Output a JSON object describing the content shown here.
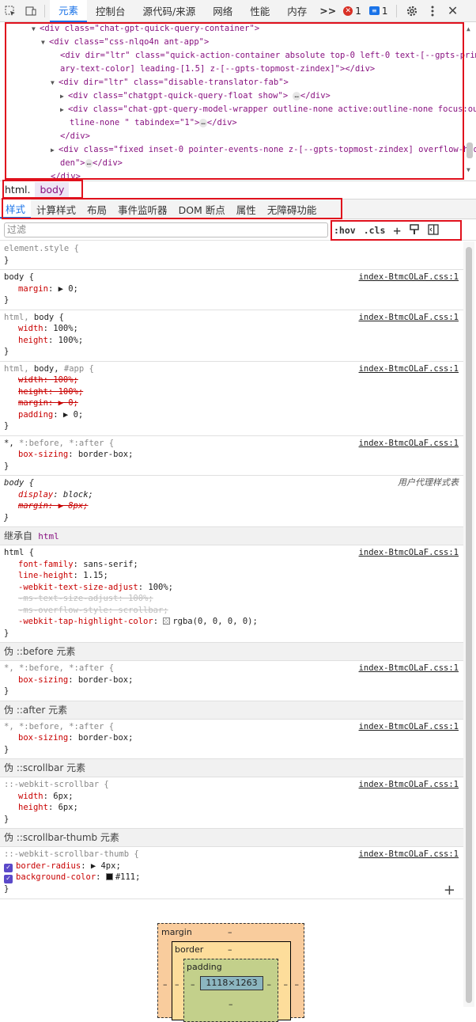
{
  "toolbar": {
    "tabs": [
      "元素",
      "控制台",
      "源代码/来源",
      "网络",
      "性能",
      "内存"
    ],
    "more": ">>",
    "errors": "1",
    "messages": "1",
    "colors": {
      "accent": "#1a73e8",
      "error": "#d93025"
    }
  },
  "dom": {
    "lines": [
      {
        "a": "<div class=\"chat-gpt-quick-query-container\">"
      },
      {
        "a": "<div class=\"css-nlqo4n ant-app\">"
      },
      {
        "a": "<div dir=\"ltr\" class=\"quick-action-container absolute top-0 left-0 text-[--gpts-prim"
      },
      {
        "a": "ary-text-color] leading-[1.5] z-[--gpts-topmost-zindex]\"></div>"
      },
      {
        "a": "<div dir=\"ltr\" class=\"disable-translator-fab\">"
      },
      {
        "a": "<div class=\"chatgpt-quick-query-float show\">",
        "b": "</div>"
      },
      {
        "a": "<div class=\"chat-gpt-query-model-wrapper outline-none active:outline-none focus:ou"
      },
      {
        "a": "tline-none \" tabindex=\"1\">",
        "b": "</div>"
      },
      {
        "a": "</div>"
      },
      {
        "a": "<div class=\"fixed inset-0 pointer-events-none z-[--gpts-topmost-zindex] overflow-hid"
      },
      {
        "a": "den\">",
        "b": "</div>"
      },
      {
        "a": "</div>"
      }
    ],
    "ellipsis": "…"
  },
  "breadcrumb": [
    "html.",
    "body"
  ],
  "subtabs": [
    "样式",
    "计算样式",
    "布局",
    "事件监听器",
    "DOM 断点",
    "属性",
    "无障碍功能"
  ],
  "filter": {
    "placeholder": "过滤",
    "hov": ":hov",
    "cls": ".cls",
    "add": "+"
  },
  "styles": {
    "element_style": "element.style {",
    "close": "}",
    "src": "index-BtmcOLaF.css:1",
    "ua": "用户代理样式表",
    "r1_sel": "body {",
    "r1_p1": "margin",
    "r1_v1": "▶ 0;",
    "r2_sel_a": "html,",
    "r2_sel_b": " body {",
    "r2_p1": "width",
    "r2_v1": "100%;",
    "r2_p2": "height",
    "r2_v2": "100%;",
    "r3_sel_a": "html,",
    "r3_sel_b": " body,",
    "r3_sel_c": " #app {",
    "r3_p1": "width: 100%;",
    "r3_p2": "height: 100%;",
    "r3_p3": "margin: ▶ 0;",
    "r3_p4": "padding",
    "r3_v4": "▶ 0;",
    "r4_sel_a": "*,",
    "r4_sel_b": " *:before, *:after {",
    "r4_p1": "box-sizing",
    "r4_v1": "border-box;",
    "r5_sel": "body {",
    "r5_p1": "display",
    "r5_v1": "block;",
    "r5_p2": "margin: ▶ 8px;",
    "inherit": "继承自",
    "inherit_el": "html",
    "r6_sel": "html {",
    "r6_p1": "font-family",
    "r6_v1": "sans-serif;",
    "r6_p2": "line-height",
    "r6_v2": "1.15;",
    "r6_p3": "-webkit-text-size-adjust",
    "r6_v3": "100%;",
    "r6_p4": "-ms-text-size-adjust: 100%;",
    "r6_p5": "-ms-overflow-style: scrollbar;",
    "r6_p6": "-webkit-tap-highlight-color",
    "r6_v6": "rgba(0, 0, 0, 0);",
    "sect_before": "伪 ::before 元素",
    "sect_after": "伪 ::after 元素",
    "sect_scrollbar": "伪 ::scrollbar 元素",
    "sect_thumb": "伪 ::scrollbar-thumb 元素",
    "r7_sel": "*, *:before, *:after {",
    "r8_sel": "*, *:before, *:after {",
    "r9_sel": "::-webkit-scrollbar {",
    "r9_p1": "width",
    "r9_v1": "6px;",
    "r9_p2": "height",
    "r9_v2": "6px;",
    "r10_sel": "::-webkit-scrollbar-thumb {",
    "r10_p1": "border-radius",
    "r10_v1": "▶ 4px;",
    "r10_p2": "background-color",
    "r10_v2": "#111;",
    "add_rule": "+"
  },
  "boxmodel": {
    "margin": "margin",
    "border": "border",
    "padding": "padding",
    "content": "1118×1263",
    "dash": "–"
  }
}
